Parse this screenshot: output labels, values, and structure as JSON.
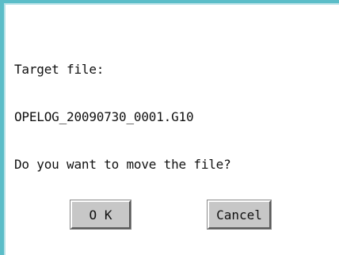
{
  "dialog": {
    "message_lines": [
      "Target file:",
      "OPELOG_20090730_0001.G10",
      "Do you want to move the file?"
    ],
    "ok_label": "O K",
    "cancel_label": "Cancel",
    "accent_color": "#5bbdc8",
    "button_color": "#c7c7c7"
  }
}
